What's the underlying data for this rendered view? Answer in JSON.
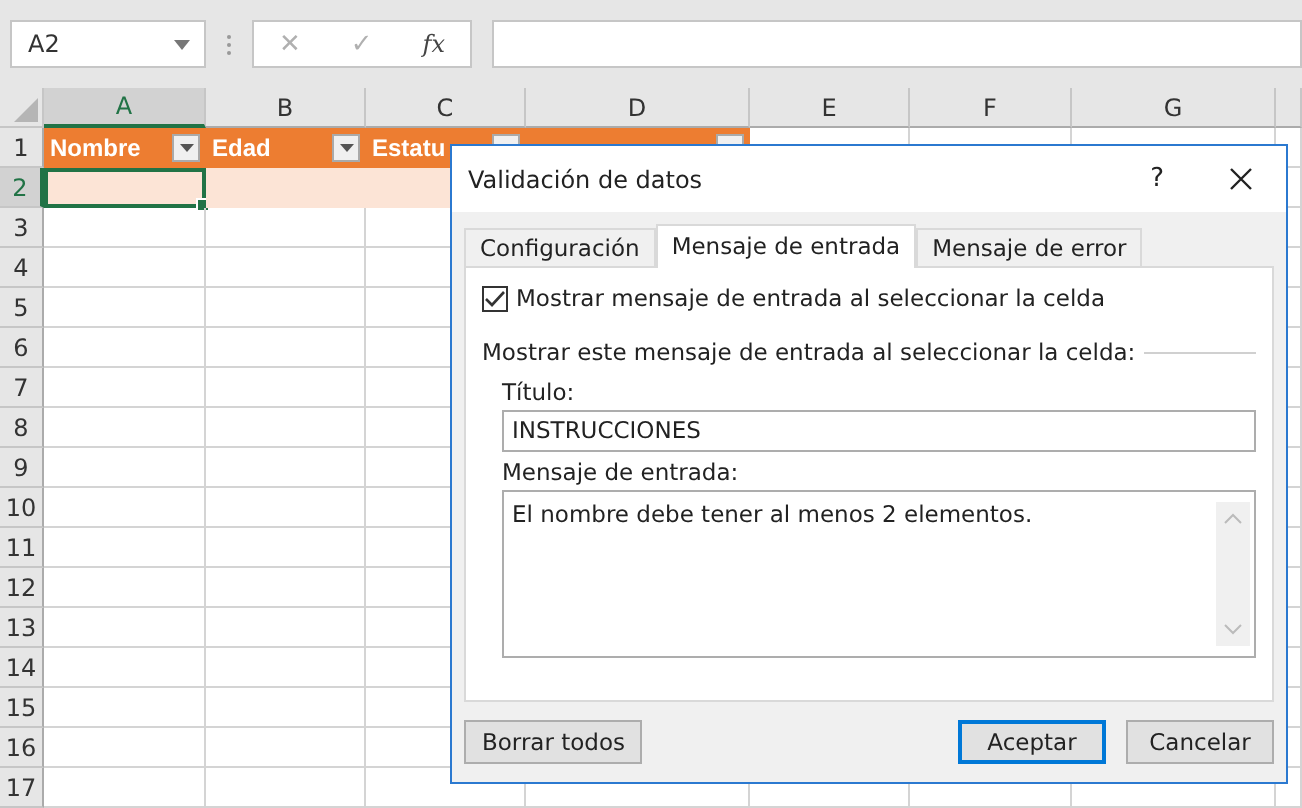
{
  "name_box": {
    "value": "A2"
  },
  "formula_bar": {
    "buttons": [
      "✕",
      "✓",
      "fx"
    ]
  },
  "columns": [
    {
      "label": "A",
      "selected": true
    },
    {
      "label": "B",
      "selected": false
    },
    {
      "label": "C",
      "selected": false
    },
    {
      "label": "D",
      "selected": false
    },
    {
      "label": "E",
      "selected": false
    },
    {
      "label": "F",
      "selected": false
    },
    {
      "label": "G",
      "selected": false
    }
  ],
  "header_cells": [
    {
      "text": "Nombre"
    },
    {
      "text": "Edad"
    },
    {
      "text": "Estatu"
    }
  ],
  "rows": [
    {
      "number": "1",
      "selected": false
    },
    {
      "number": "2",
      "selected": true
    },
    {
      "number": "3",
      "selected": false
    },
    {
      "number": "4",
      "selected": false
    },
    {
      "number": "5",
      "selected": false
    },
    {
      "number": "6",
      "selected": false
    },
    {
      "number": "7",
      "selected": false
    },
    {
      "number": "8",
      "selected": false
    },
    {
      "number": "9",
      "selected": false
    },
    {
      "number": "10",
      "selected": false
    },
    {
      "number": "11",
      "selected": false
    },
    {
      "number": "12",
      "selected": false
    },
    {
      "number": "13",
      "selected": false
    },
    {
      "number": "14",
      "selected": false
    },
    {
      "number": "15",
      "selected": false
    },
    {
      "number": "16",
      "selected": false
    },
    {
      "number": "17",
      "selected": false
    }
  ],
  "dialog": {
    "title": "Validación de datos",
    "help": "?",
    "tabs": [
      {
        "label": "Configuración",
        "selected": false
      },
      {
        "label": "Mensaje de entrada",
        "selected": true
      },
      {
        "label": "Mensaje de error",
        "selected": false
      }
    ],
    "show_checkbox": {
      "label": "Mostrar mensaje de entrada al seleccionar la celda",
      "checked": true
    },
    "group_label": "Mostrar este mensaje de entrada al seleccionar la celda:",
    "title_label": "Título:",
    "title_value": "INSTRUCCIONES",
    "message_label": "Mensaje de entrada:",
    "message_value": "El nombre debe tener al menos 2 elementos.",
    "buttons": [
      {
        "label": "Borrar todos",
        "kind": "secondary"
      },
      {
        "label": "Aceptar",
        "kind": "default"
      },
      {
        "label": "Cancelar",
        "kind": "secondary"
      }
    ]
  }
}
